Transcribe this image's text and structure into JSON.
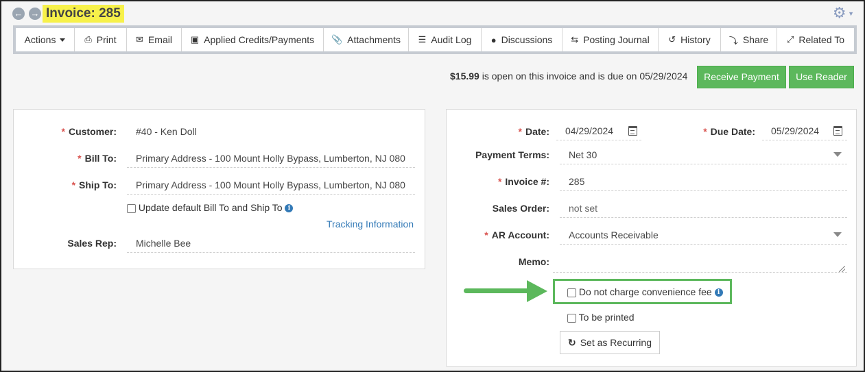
{
  "header": {
    "title": "Invoice: 285",
    "back_icon": "arrow-left-circle-icon",
    "forward_icon": "arrow-right-circle-icon",
    "settings_icon": "gear-icon"
  },
  "toolbar": {
    "items": [
      {
        "label": "Actions",
        "icon": "caret-down-icon"
      },
      {
        "label": "Print",
        "icon": "printer-icon"
      },
      {
        "label": "Email",
        "icon": "envelope-icon"
      },
      {
        "label": "Applied Credits/Payments",
        "icon": "money-icon"
      },
      {
        "label": "Attachments",
        "icon": "paperclip-icon"
      },
      {
        "label": "Audit Log",
        "icon": "list-icon"
      },
      {
        "label": "Discussions",
        "icon": "comments-icon"
      },
      {
        "label": "Posting Journal",
        "icon": "exchange-icon"
      },
      {
        "label": "History",
        "icon": "history-icon"
      },
      {
        "label": "Share",
        "icon": "share-icon"
      },
      {
        "label": "Related To",
        "icon": "expand-icon"
      }
    ]
  },
  "payment": {
    "amount": "$15.99",
    "due_text": " is open on this invoice and is due on 05/29/2024",
    "receive_label": "Receive Payment",
    "reader_label": "Use Reader"
  },
  "left_panel": {
    "customer_label": "Customer:",
    "customer_value": "#40 - Ken Doll",
    "bill_to_label": "Bill To:",
    "bill_to_value": "Primary Address - 100 Mount Holly Bypass, Lumberton, NJ 080",
    "ship_to_label": "Ship To:",
    "ship_to_value": "Primary Address - 100 Mount Holly Bypass, Lumberton, NJ 080",
    "update_default_label": "Update default Bill To and Ship To",
    "tracking_link": "Tracking Information",
    "sales_rep_label": "Sales Rep:",
    "sales_rep_value": "Michelle Bee"
  },
  "right_panel": {
    "date_label": "Date:",
    "date_value": "04/29/2024",
    "due_date_label": "Due Date:",
    "due_date_value": "05/29/2024",
    "payment_terms_label": "Payment Terms:",
    "payment_terms_value": "Net 30",
    "invoice_label": "Invoice #:",
    "invoice_value": "285",
    "sales_order_label": "Sales Order:",
    "sales_order_value": "not set",
    "ar_account_label": "AR Account:",
    "ar_account_value": "Accounts Receivable",
    "memo_label": "Memo:",
    "memo_value": "",
    "convenience_fee_label": "Do not charge convenience fee",
    "to_be_printed_label": "To be printed",
    "recurring_label": "Set as Recurring"
  },
  "colors": {
    "accent_green": "#5cb85c",
    "highlight_yellow": "#f7f14a",
    "link_blue": "#337ab7",
    "required_red": "#d9534f"
  }
}
